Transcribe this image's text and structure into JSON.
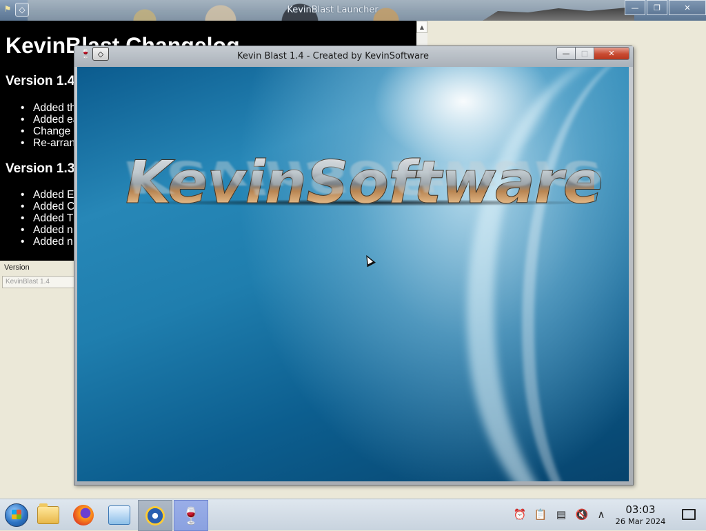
{
  "launcher": {
    "title": "KevinBlast Launcher",
    "changelog": {
      "heading": "KevinBlast Changelog",
      "sections": [
        {
          "version": "Version 1.4",
          "items": [
            "Added th",
            "Added ea",
            "Change",
            "Re-arran"
          ]
        },
        {
          "version": "Version 1.3",
          "items": [
            "Added E",
            "Added C",
            "Added T",
            "Added n",
            "Added n"
          ]
        }
      ]
    },
    "version_label": "Version",
    "version_value": "KevinBlast 1.4",
    "buttons": {
      "minimize": "—",
      "restore": "❐",
      "close": "✕"
    }
  },
  "game": {
    "title": "Kevin Blast 1.4 - Created by KevinSoftware",
    "logo_text": "KevinSoftware",
    "buttons": {
      "minimize": "—",
      "maximize": "□",
      "close": "✕"
    }
  },
  "taskbar": {
    "apps": [
      "start-menu",
      "file-manager",
      "firefox",
      "remote-desktop",
      "kevinblast-launcher",
      "wine"
    ],
    "tray": [
      "notification-bell-icon",
      "clipboard-icon",
      "storage-icon",
      "volume-muted-icon",
      "tray-expand-icon"
    ],
    "clock": {
      "time": "03:03",
      "date": "26 Mar 2024"
    }
  }
}
